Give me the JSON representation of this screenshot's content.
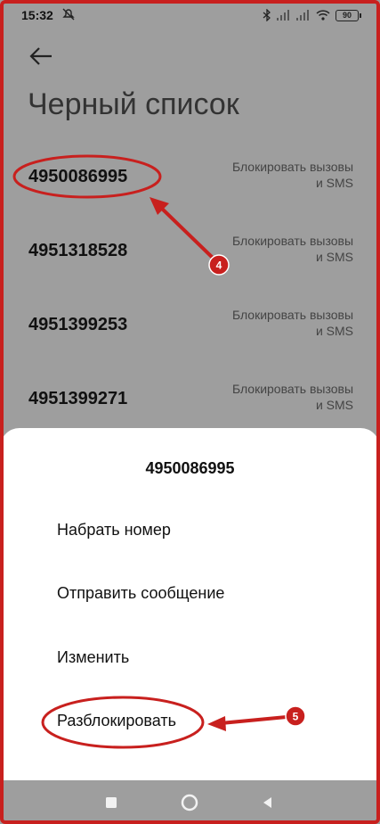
{
  "status_bar": {
    "time": "15:32",
    "battery": "90"
  },
  "header": {
    "title": "Черный список"
  },
  "blacklist": [
    {
      "number": "4950086995",
      "status": "Блокировать вызовы и SMS"
    },
    {
      "number": "4951318528",
      "status": "Блокировать вызовы и SMS"
    },
    {
      "number": "4951399253",
      "status": "Блокировать вызовы и SMS"
    },
    {
      "number": "4951399271",
      "status": "Блокировать вызовы и SMS"
    }
  ],
  "sheet": {
    "title": "4950086995",
    "items": [
      "Набрать номер",
      "Отправить сообщение",
      "Изменить",
      "Разблокировать"
    ]
  },
  "annotations": {
    "step4": "4",
    "step5": "5"
  },
  "colors": {
    "annotation_red": "#c8201e",
    "dim_background": "#9e9e9e"
  }
}
